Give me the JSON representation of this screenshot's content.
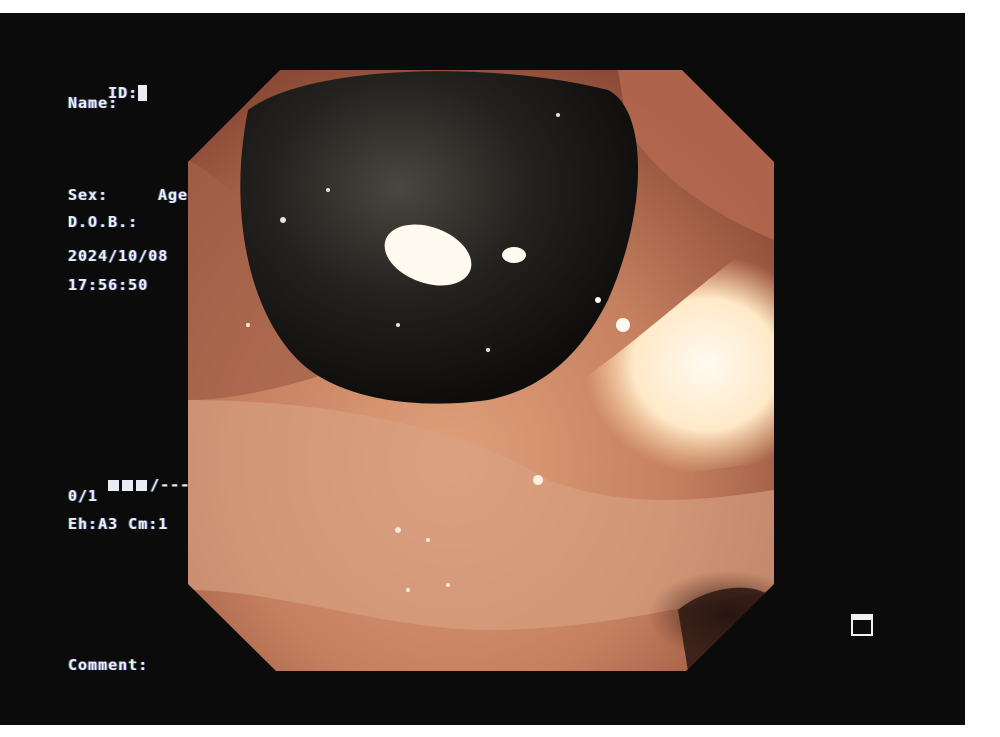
{
  "osd": {
    "id_label": "ID:",
    "name_label": "Name:",
    "sex_label": "Sex:",
    "age_label": "Age:",
    "dob_label": "D.O.B.:",
    "date": "2024/10/08",
    "time": "17:56:50",
    "status_suffix": "/---",
    "counter": "0/1",
    "settings": "Eh:A3 Cm:1",
    "comment_label": "Comment:"
  },
  "view": {
    "type": "endoscopy image",
    "colors": {
      "background": "#0b0b0c",
      "mucosa": "#c9876a",
      "stone": "#1c1a18",
      "highlight": "#fff4dc"
    }
  },
  "icons": {
    "frame_indicator": "window-frame-icon"
  }
}
